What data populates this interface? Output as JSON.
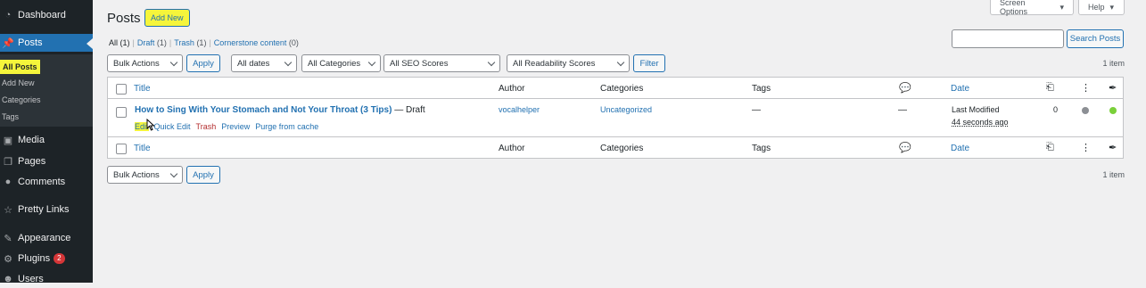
{
  "sidebar": {
    "items": [
      {
        "label": "Dashboard",
        "icon": "dashboard-icon"
      },
      {
        "label": "Posts",
        "icon": "pin-icon"
      },
      {
        "label": "Media",
        "icon": "media-icon"
      },
      {
        "label": "Pages",
        "icon": "pages-icon"
      },
      {
        "label": "Comments",
        "icon": "comment-icon"
      },
      {
        "label": "Pretty Links",
        "icon": "link-icon"
      },
      {
        "label": "Appearance",
        "icon": "brush-icon"
      },
      {
        "label": "Plugins",
        "icon": "plugin-icon",
        "badge": "2"
      },
      {
        "label": "Users",
        "icon": "user-icon"
      }
    ],
    "submenu": [
      "All Posts",
      "Add New",
      "Categories",
      "Tags"
    ]
  },
  "top": {
    "screen_options": "Screen Options",
    "help": "Help"
  },
  "page": {
    "title": "Posts",
    "add_new": "Add New"
  },
  "filters": {
    "all": "All",
    "all_count": "(1)",
    "draft": "Draft",
    "draft_count": "(1)",
    "trash": "Trash",
    "trash_count": "(1)",
    "cornerstone": "Cornerstone content",
    "cornerstone_count": "(0)"
  },
  "search": {
    "button": "Search Posts",
    "value": ""
  },
  "toolbar": {
    "bulk_actions": "Bulk Actions",
    "apply": "Apply",
    "dates": "All dates",
    "categories": "All Categories",
    "seo": "All SEO Scores",
    "readability": "All Readability Scores",
    "filter": "Filter",
    "item_count": "1 item"
  },
  "table": {
    "headers": {
      "title": "Title",
      "author": "Author",
      "categories": "Categories",
      "tags": "Tags",
      "date": "Date"
    },
    "row": {
      "title": "How to Sing With Your Stomach and Not Your Throat (3 Tips)",
      "state": "— Draft",
      "actions": {
        "edit": "Edit",
        "quick_edit": "Quick Edit",
        "trash": "Trash",
        "preview": "Preview",
        "purge": "Purge from cache"
      },
      "author": "vocalhelper",
      "categories": "Uncategorized",
      "tags": "—",
      "comments": "—",
      "date_label": "Last Modified",
      "date_value": "44 seconds ago",
      "links": "0"
    }
  },
  "bottom": {
    "bulk_actions": "Bulk Actions",
    "apply": "Apply",
    "item_count": "1 item"
  },
  "colors": {
    "sidebar": "#1d2327",
    "accent": "#2271b1",
    "highlight": "#f5f53b",
    "seo_dot": "#8c8f94",
    "readability_dot": "#7ad03a"
  }
}
